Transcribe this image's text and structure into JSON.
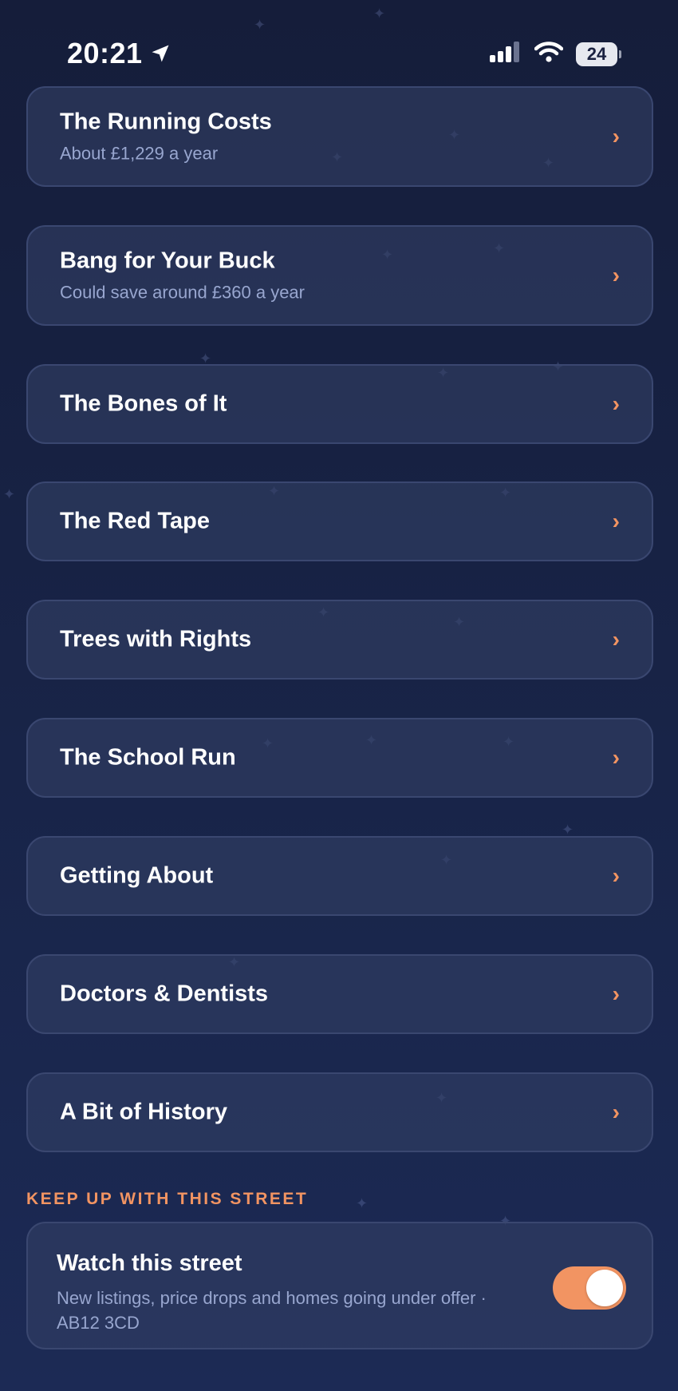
{
  "status_bar": {
    "time": "20:21",
    "battery_level": "24",
    "icons": [
      "location-arrow-icon",
      "cellular-signal-icon",
      "wifi-icon",
      "battery-icon"
    ]
  },
  "sections": [
    {
      "title": "The Running Costs",
      "subtitle": "About £1,229 a year"
    },
    {
      "title": "Bang for Your Buck",
      "subtitle": "Could save around £360 a year"
    },
    {
      "title": "The Bones of It"
    },
    {
      "title": "The Red Tape"
    },
    {
      "title": "Trees with Rights"
    },
    {
      "title": "The School Run"
    },
    {
      "title": "Getting About"
    },
    {
      "title": "Doctors & Dentists"
    },
    {
      "title": "A Bit of History"
    }
  ],
  "chevron_glyph": "›",
  "watch_section": {
    "header": "KEEP UP WITH THIS STREET",
    "title": "Watch this street",
    "description": "New listings, price drops and homes going under offer · AB12 3CD",
    "toggle_on": true
  },
  "colors": {
    "accent": "#f29462",
    "background": "#182448",
    "card_background": "#323f64",
    "card_border": "#3a4770",
    "subtitle_text": "#98a6cf"
  }
}
